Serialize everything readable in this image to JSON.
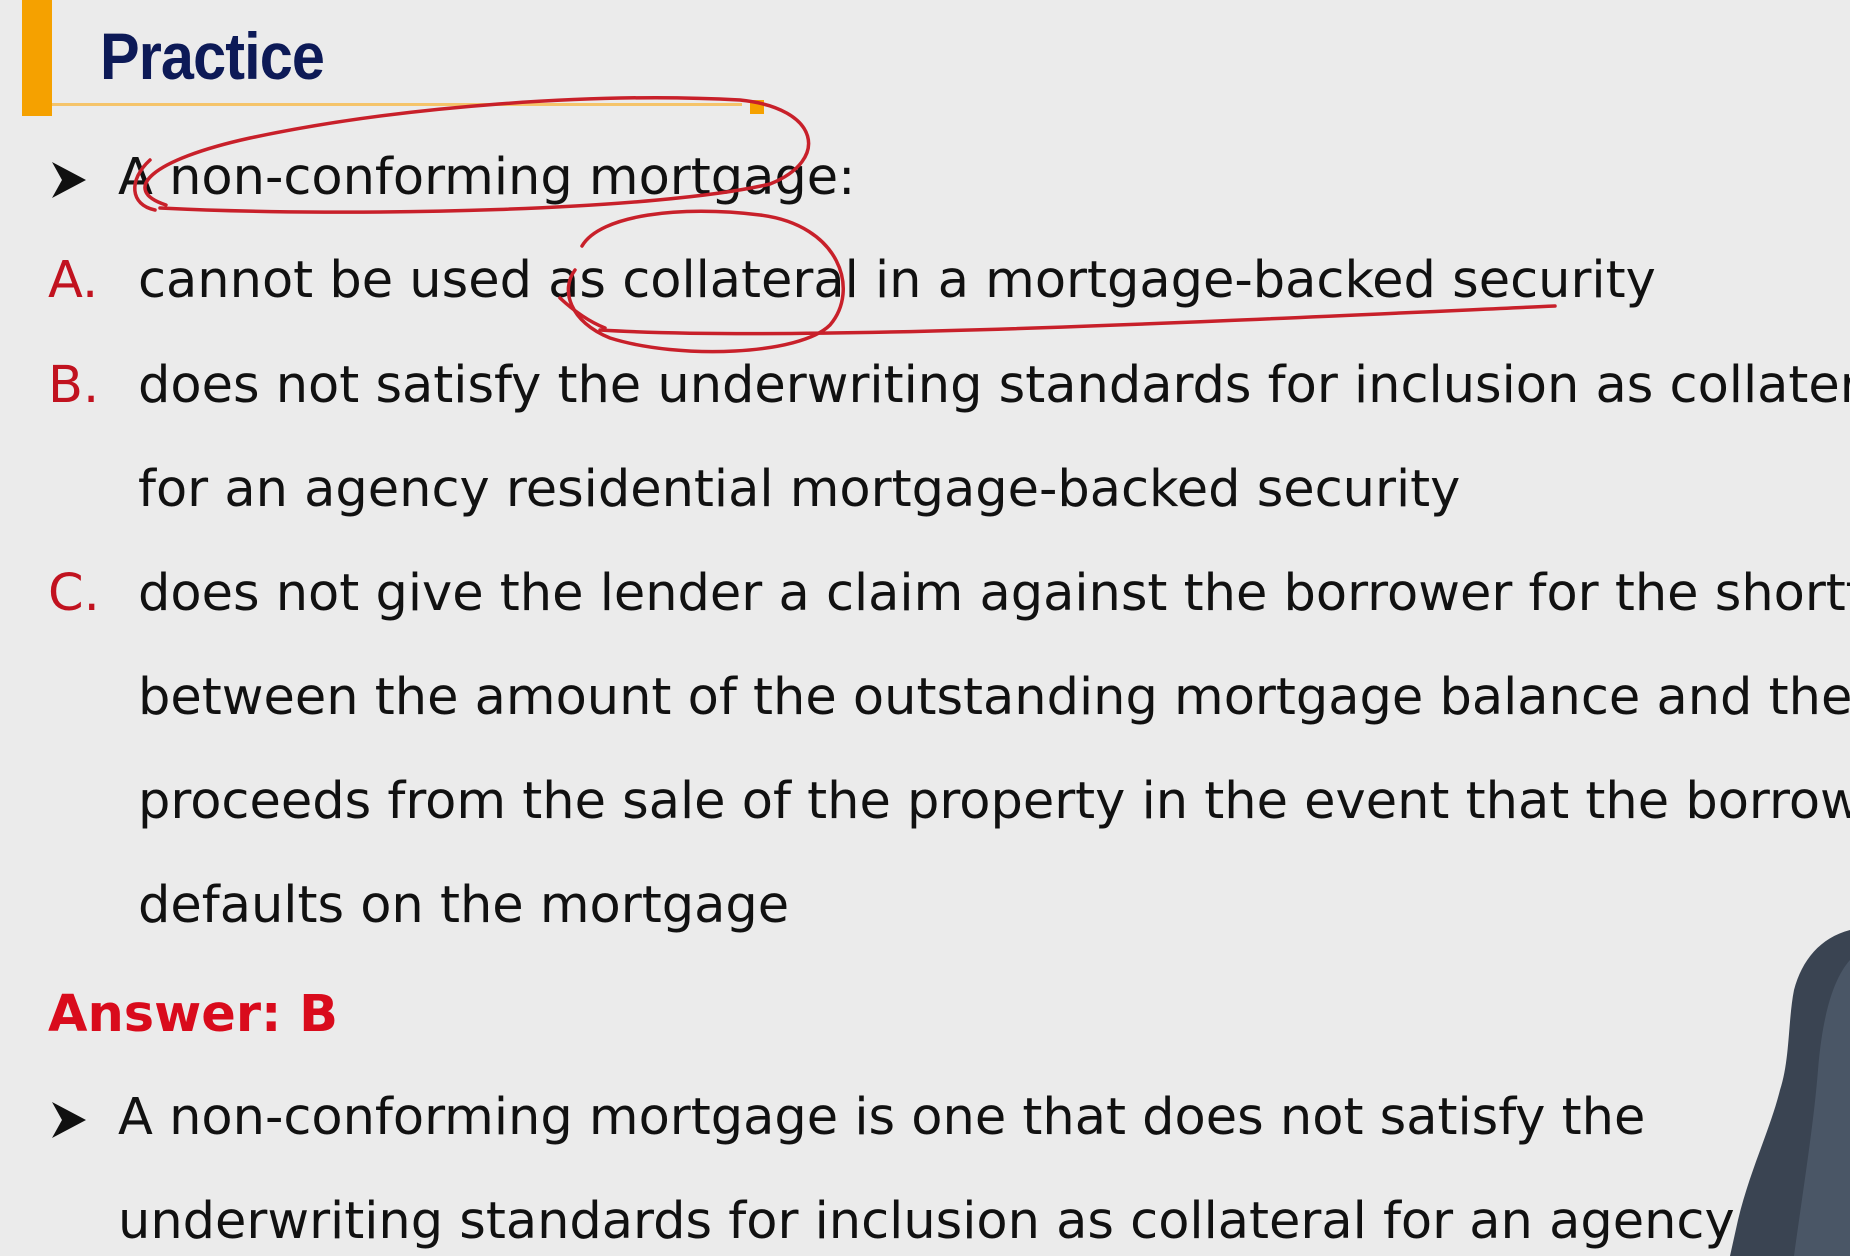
{
  "slide": {
    "title": "Practice",
    "question": "A non-conforming mortgage:",
    "options": [
      {
        "letter": "A.",
        "lines": [
          "cannot be used as collateral in a mortgage-backed security"
        ]
      },
      {
        "letter": "B.",
        "lines": [
          "does not satisfy the underwriting standards for inclusion as collateral",
          "for an agency residential mortgage-backed security"
        ]
      },
      {
        "letter": "C.",
        "lines": [
          "does not give the lender a claim against the borrower for the shortfall",
          "between the amount of the outstanding mortgage balance and the",
          "proceeds from the sale of the property in the event that the borrower",
          "defaults on the mortgage"
        ]
      }
    ],
    "answer": "Answer: B",
    "explanation": {
      "line1": "A non-conforming mortgage is one that does not satisfy the",
      "line2": "underwriting standards for inclusion as collateral for an agency RM"
    }
  },
  "colors": {
    "background": "#ebebeb",
    "title": "#0d1a57",
    "accent_bar": "#f5a100",
    "option_letter": "#c1121f",
    "answer": "#d90b1c",
    "annotation_ink": "#c8202a"
  },
  "icons": [
    "arrow-bullet-icon",
    "pen-annotation"
  ]
}
